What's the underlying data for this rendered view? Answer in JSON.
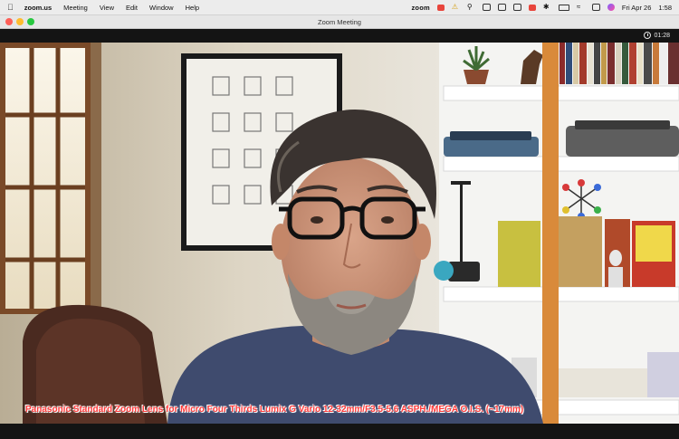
{
  "menubar": {
    "app_name": "zoom.us",
    "items": [
      "Meeting",
      "View",
      "Edit",
      "Window",
      "Help"
    ],
    "zoom_label": "zoom",
    "date": "Fri Apr 26",
    "time": "1:58"
  },
  "window": {
    "title": "Zoom Meeting"
  },
  "meeting": {
    "elapsed": "01:28"
  },
  "overlay": {
    "caption": "Panasonic Standard Zoom Lens for Micro Four Thirds Lumix G Vario 12-32mm/F3.5-5.6 ASPH./MEGA O.I.S. (~17mm)"
  },
  "colors": {
    "caption": "#ff3b3b",
    "bookshelf_post": "#d98a3a"
  }
}
